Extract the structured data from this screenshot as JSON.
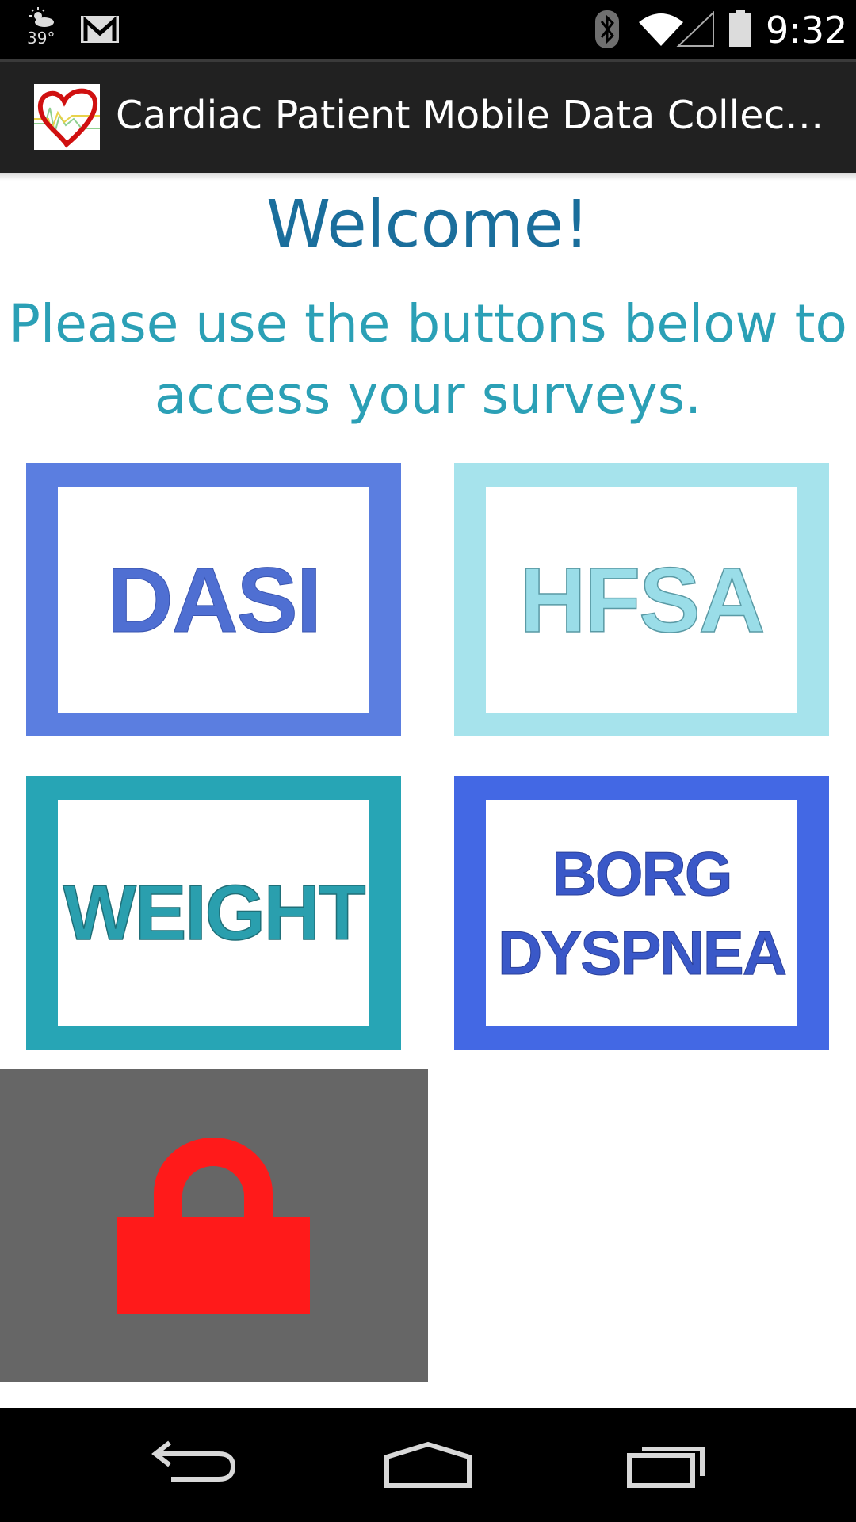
{
  "status_bar": {
    "temperature": "39°",
    "time": "9:32",
    "icons": [
      "weather-icon",
      "gmail-icon",
      "bluetooth-icon",
      "wifi-icon",
      "cell-signal-icon",
      "battery-icon"
    ]
  },
  "action_bar": {
    "title": "Cardiac Patient Mobile Data Collection",
    "logo": "heart-logo-icon"
  },
  "main": {
    "heading": "Welcome!",
    "instructions": "Please use the buttons below to access your surveys.",
    "tiles": [
      {
        "label": "DASI",
        "color": "#5b7ee0"
      },
      {
        "label": "HFSA",
        "color": "#a6e3ec"
      },
      {
        "label": "WEIGHT",
        "color": "#27a5b5"
      },
      {
        "label_line1": "BORG",
        "label_line2": "DYSPNEA",
        "color": "#4368e4"
      }
    ],
    "lock_tile": {
      "icon": "lock-icon",
      "icon_color": "#ff1a1a",
      "background": "#666666"
    }
  },
  "colors": {
    "heading": "#1a6e9c",
    "instructions": "#2ba0b6",
    "status_bar": "#000000",
    "action_bar": "#212121"
  },
  "nav_bar": {
    "buttons": [
      "back-icon",
      "home-icon",
      "recents-icon"
    ]
  }
}
